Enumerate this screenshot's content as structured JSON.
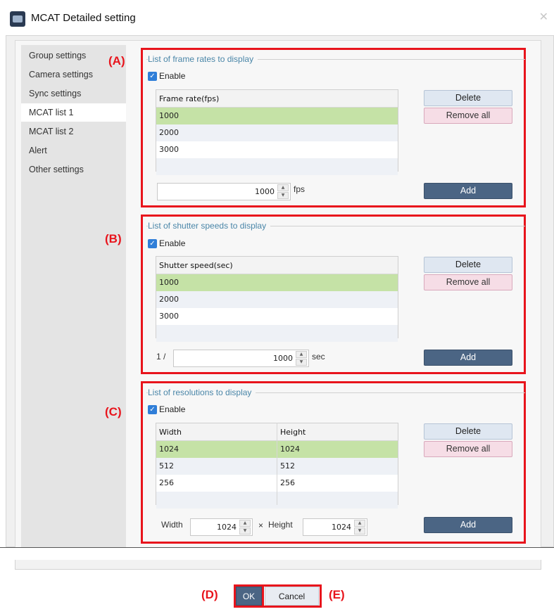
{
  "window": {
    "title": "MCAT Detailed setting",
    "icon": "camera-app-icon",
    "close_glyph": "✕"
  },
  "sidebar": {
    "items": [
      {
        "label": "Group settings"
      },
      {
        "label": "Camera settings"
      },
      {
        "label": "Sync settings"
      },
      {
        "label": "MCAT list 1",
        "selected": true
      },
      {
        "label": "MCAT list 2"
      },
      {
        "label": "Alert"
      },
      {
        "label": "Other settings"
      }
    ]
  },
  "annotations": {
    "a": "(A)",
    "b": "(B)",
    "c": "(C)",
    "d": "(D)",
    "e": "(E)"
  },
  "frame_rates": {
    "group_title": "List of frame rates to display",
    "enable_label": "Enable",
    "enabled": true,
    "column": "Frame rate(fps)",
    "rows": [
      "1000",
      "2000",
      "3000"
    ],
    "selected_row": 0,
    "input_value": "1000",
    "unit": "fps",
    "delete_label": "Delete",
    "remove_all_label": "Remove all",
    "add_label": "Add"
  },
  "shutter_speeds": {
    "group_title": "List of shutter speeds to display",
    "enable_label": "Enable",
    "enabled": true,
    "column": "Shutter speed(sec)",
    "rows": [
      "1000",
      "2000",
      "3000"
    ],
    "selected_row": 0,
    "prefix": "1 /",
    "input_value": "1000",
    "unit": "sec",
    "delete_label": "Delete",
    "remove_all_label": "Remove all",
    "add_label": "Add"
  },
  "resolutions": {
    "group_title": "List of resolutions to display",
    "enable_label": "Enable",
    "enabled": true,
    "columns": [
      "Width",
      "Height"
    ],
    "rows": [
      [
        "1024",
        "1024"
      ],
      [
        "512",
        "512"
      ],
      [
        "256",
        "256"
      ]
    ],
    "selected_row": 0,
    "width_label": "Width",
    "width_value": "1024",
    "times": "×",
    "height_label": "Height",
    "height_value": "1024",
    "delete_label": "Delete",
    "remove_all_label": "Remove all",
    "add_label": "Add"
  },
  "footer": {
    "ok_label": "OK",
    "cancel_label": "Cancel"
  },
  "colors": {
    "highlight_box": "#e8141c",
    "group_title": "#4a86a8",
    "selected_row": "#c5e2a6",
    "add_button": "#4b6584",
    "remove_all_button": "#f6dde6",
    "delete_button": "#dfe7f1"
  }
}
